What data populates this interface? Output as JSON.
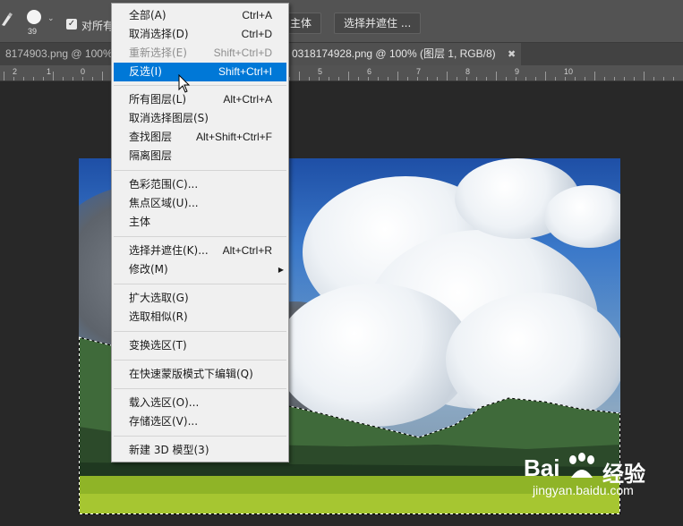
{
  "options_bar": {
    "brush_size": "39",
    "checkbox_label": "对所有",
    "subject_button": "主体",
    "select_and_mask_button": "选择并遮住 ..."
  },
  "tabs": [
    {
      "label": "8174903.png @ 100%"
    },
    {
      "label": "0318174928.png @ 100% (图层 1, RGB/8)",
      "close": "✖"
    }
  ],
  "ruler": {
    "labels": [
      "2",
      "1",
      "0",
      "5",
      "6",
      "7",
      "8",
      "9",
      "10"
    ]
  },
  "menu": {
    "items": [
      {
        "label": "全部(A)",
        "shortcut": "Ctrl+A"
      },
      {
        "label": "取消选择(D)",
        "shortcut": "Ctrl+D"
      },
      {
        "label": "重新选择(E)",
        "shortcut": "Shift+Ctrl+D",
        "disabled": true
      },
      {
        "label": "反选(I)",
        "shortcut": "Shift+Ctrl+I",
        "highlighted": true
      },
      {
        "label": "所有图层(L)",
        "shortcut": "Alt+Ctrl+A"
      },
      {
        "label": "取消选择图层(S)",
        "shortcut": ""
      },
      {
        "label": "查找图层",
        "shortcut": "Alt+Shift+Ctrl+F"
      },
      {
        "label": "隔离图层",
        "shortcut": ""
      },
      {
        "label": "色彩范围(C)...",
        "shortcut": ""
      },
      {
        "label": "焦点区域(U)...",
        "shortcut": ""
      },
      {
        "label": "主体",
        "shortcut": ""
      },
      {
        "label": "选择并遮住(K)...",
        "shortcut": "Alt+Ctrl+R"
      },
      {
        "label": "修改(M)",
        "shortcut": "",
        "submenu": true
      },
      {
        "label": "扩大选取(G)",
        "shortcut": ""
      },
      {
        "label": "选取相似(R)",
        "shortcut": ""
      },
      {
        "label": "变换选区(T)",
        "shortcut": ""
      },
      {
        "label": "在快速蒙版模式下编辑(Q)",
        "shortcut": ""
      },
      {
        "label": "载入选区(O)...",
        "shortcut": ""
      },
      {
        "label": "存储选区(V)...",
        "shortcut": ""
      },
      {
        "label": "新建 3D 模型(3)",
        "shortcut": ""
      }
    ]
  },
  "watermark": {
    "brand": "Bai",
    "brand_cn": "经验",
    "url": "jingyan.baidu.com"
  },
  "colors": {
    "menu_highlight": "#0078d7",
    "menu_bg": "#f0f0f0",
    "app_bg": "#282828",
    "toolbar_bg": "#535353"
  }
}
